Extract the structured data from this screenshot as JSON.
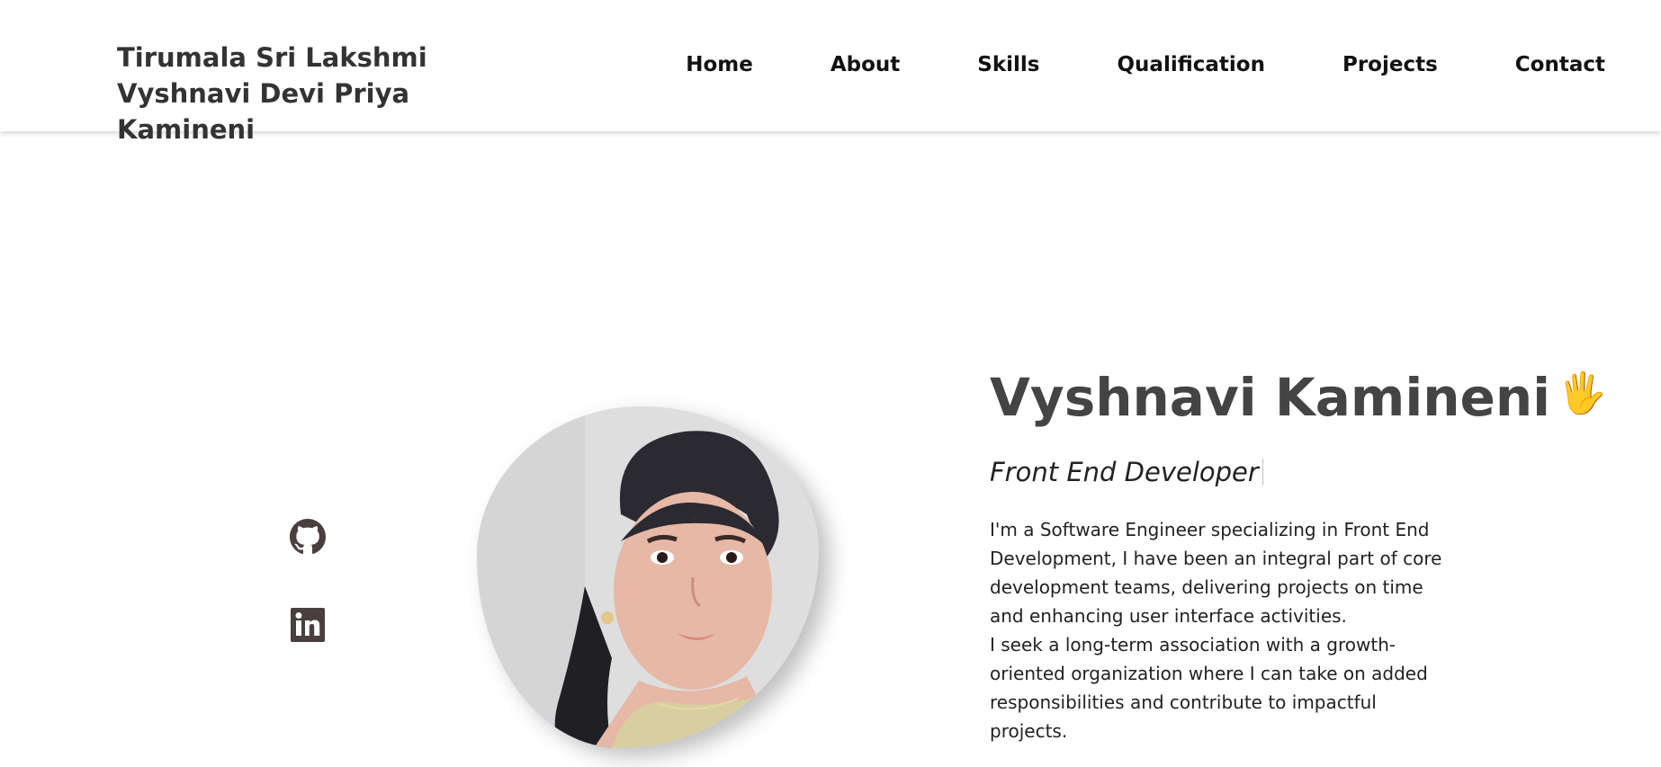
{
  "header": {
    "brand": "Tirumala Sri Lakshmi Vyshnavi Devi Priya Kamineni",
    "nav": [
      {
        "label": "Home"
      },
      {
        "label": "About"
      },
      {
        "label": "Skills"
      },
      {
        "label": "Qualification"
      },
      {
        "label": "Projects"
      },
      {
        "label": "Contact"
      }
    ]
  },
  "social": [
    {
      "icon": "github-icon"
    },
    {
      "icon": "linkedin-icon"
    }
  ],
  "hero": {
    "name": "Vyshnavi Kamineni",
    "wave": "🖐",
    "subtitle": "Front End Developer",
    "description_1": "I'm a Software Engineer specializing in Front End Development, I have been an integral part of core development teams, delivering projects on time and enhancing user interface activities.",
    "description_2": "I seek a long-term association with a growth-oriented organization where I can take on added responsibilities and contribute to impactful projects."
  },
  "colors": {
    "icon": "#4a3f3f",
    "heading": "#444444",
    "wave": "#f5c542"
  }
}
